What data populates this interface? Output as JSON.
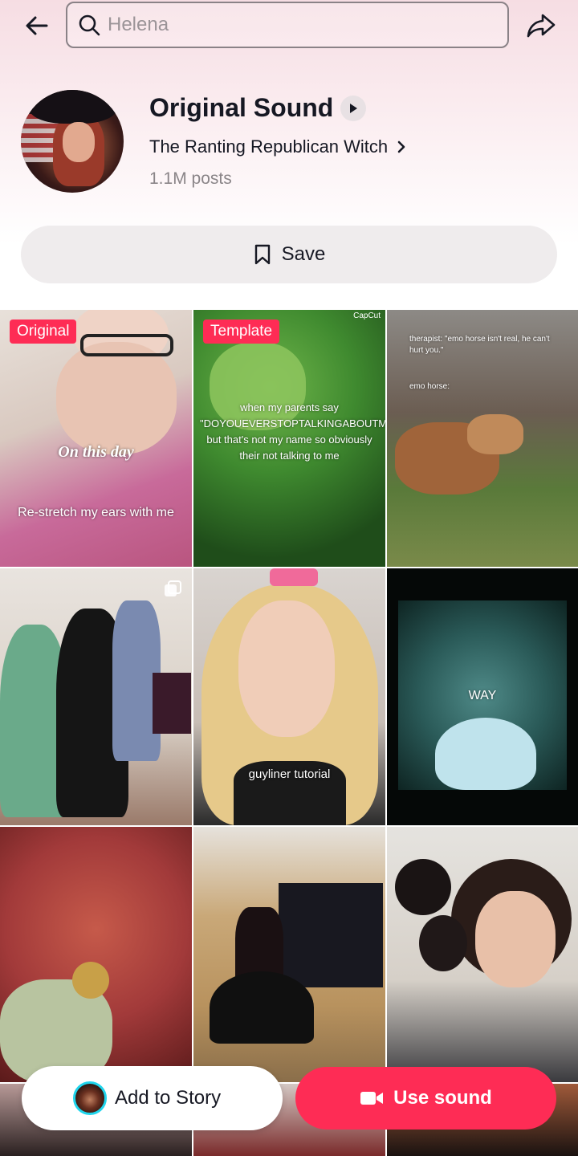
{
  "search": {
    "placeholder": "Helena"
  },
  "sound": {
    "title": "Original Sound",
    "author": "The Ranting Republican Witch",
    "posts": "1.1M posts"
  },
  "actions": {
    "save_label": "Save"
  },
  "grid": {
    "tiles": [
      {
        "badge": "Original",
        "caption": "On this day",
        "caption2": "Re-stretch my ears with me"
      },
      {
        "badge": "Template",
        "watermark": "CapCut",
        "caption": "when my parents say \"DOYOUEVERSTOPTALKINGABOUTMYCHEMICALROMANCE\" but that's not my name so obviously their not talking to me"
      },
      {
        "caption": "therapist: \"emo horse isn't real, he can't hurt you.\"",
        "caption2": "emo horse:"
      },
      {
        "caption": ""
      },
      {
        "caption": "guyliner tutorial"
      },
      {
        "caption": "WAY"
      },
      {
        "caption": ""
      },
      {
        "caption": ""
      },
      {
        "caption": ""
      }
    ]
  },
  "bottom": {
    "story_label": "Add to Story",
    "use_label": "Use sound"
  },
  "colors": {
    "accent": "#fe2c55",
    "story_ring": "#20d5ec"
  }
}
